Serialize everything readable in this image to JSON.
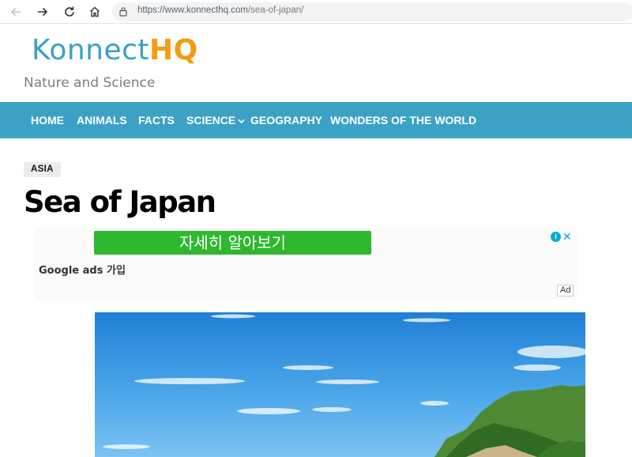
{
  "browser": {
    "url_host": "https://www.konnecthq.com",
    "url_path": "/sea-of-japan/"
  },
  "site": {
    "logo_part1": "Konnect",
    "logo_part2": "HQ",
    "tagline": "Nature and Science"
  },
  "menu": {
    "items": [
      "HOME",
      "ANIMALS",
      "FACTS",
      "SCIENCE",
      "GEOGRAPHY",
      "WONDERS OF THE WORLD"
    ]
  },
  "article": {
    "category": "ASIA",
    "title": "Sea of Japan"
  },
  "ad": {
    "cta": "자세히 알아보기",
    "advertiser": "Google ads 가입",
    "label": "Ad",
    "info_glyph": "i",
    "close_glyph": "✕"
  },
  "colors": {
    "brand_blue": "#3ba2c6",
    "brand_orange": "#f39c12",
    "ad_green": "#2db82d"
  },
  "icons": [
    "back-arrow-icon",
    "forward-arrow-icon",
    "reload-icon",
    "home-icon",
    "lock-icon",
    "chevron-down-icon",
    "ad-info-icon",
    "ad-close-icon"
  ]
}
